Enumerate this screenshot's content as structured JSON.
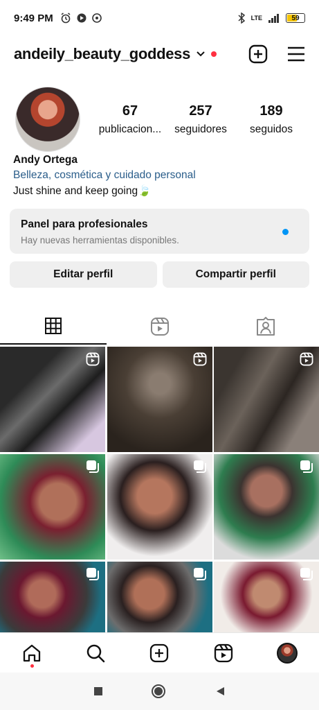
{
  "status": {
    "time": "9:49 PM",
    "network": "LTE",
    "battery": "59",
    "battery_level": 0.59
  },
  "header": {
    "username": "andeily_beauty_goddess"
  },
  "profile": {
    "stats": [
      {
        "value": "67",
        "label": "publicacion..."
      },
      {
        "value": "257",
        "label": "seguidores"
      },
      {
        "value": "189",
        "label": "seguidos"
      }
    ],
    "name": "Andy Ortega",
    "category": "Belleza, cosmética y cuidado personal",
    "bio": "Just shine and keep going🍃"
  },
  "pro_panel": {
    "title": "Panel para profesionales",
    "subtitle": "Hay nuevas herramientas disponibles."
  },
  "buttons": {
    "edit": "Editar perfil",
    "share": "Compartir perfil"
  },
  "tabs": [
    {
      "icon": "grid-icon",
      "active": true
    },
    {
      "icon": "reels-icon",
      "active": false
    },
    {
      "icon": "tagged-icon",
      "active": false
    }
  ],
  "grid": [
    {
      "type": "reel"
    },
    {
      "type": "reel"
    },
    {
      "type": "reel"
    },
    {
      "type": "carousel"
    },
    {
      "type": "carousel"
    },
    {
      "type": "carousel"
    },
    {
      "type": "carousel"
    },
    {
      "type": "carousel"
    },
    {
      "type": "carousel"
    }
  ],
  "bottom_nav": [
    "home-icon",
    "search-icon",
    "create-icon",
    "reels-icon",
    "profile-avatar"
  ],
  "colors": {
    "accent": "#0095f6",
    "notification": "#ff3040",
    "category_link": "#2a5d8a"
  }
}
